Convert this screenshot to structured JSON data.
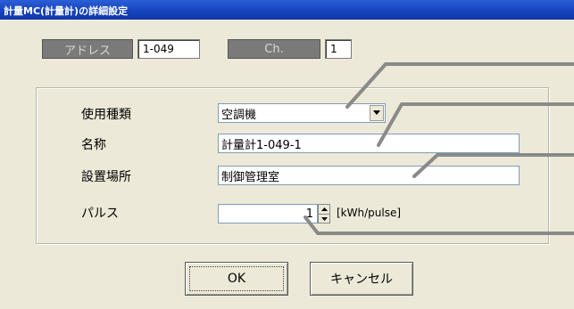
{
  "window": {
    "title": "計量MC(計量計)の詳細設定"
  },
  "header": {
    "address_label": "アドレス",
    "address_value": "1-049",
    "ch_label": "Ch.",
    "ch_value": "1"
  },
  "form": {
    "usage_type": {
      "label": "使用種類",
      "value": "空調機"
    },
    "name": {
      "label": "名称",
      "value": "計量計1-049-1"
    },
    "location": {
      "label": "設置場所",
      "value": "制御管理室"
    },
    "pulse": {
      "label": "パルス",
      "value": "1",
      "unit": "[kWh/pulse]"
    }
  },
  "buttons": {
    "ok": "OK",
    "cancel": "キャンセル"
  },
  "colors": {
    "titlebar": "#1846c0",
    "dialog_bg": "#ece9d8",
    "leader_lines": "#7a7a7a"
  },
  "icons": [
    "chevron-down-icon",
    "spin-up-icon",
    "spin-down-icon"
  ]
}
